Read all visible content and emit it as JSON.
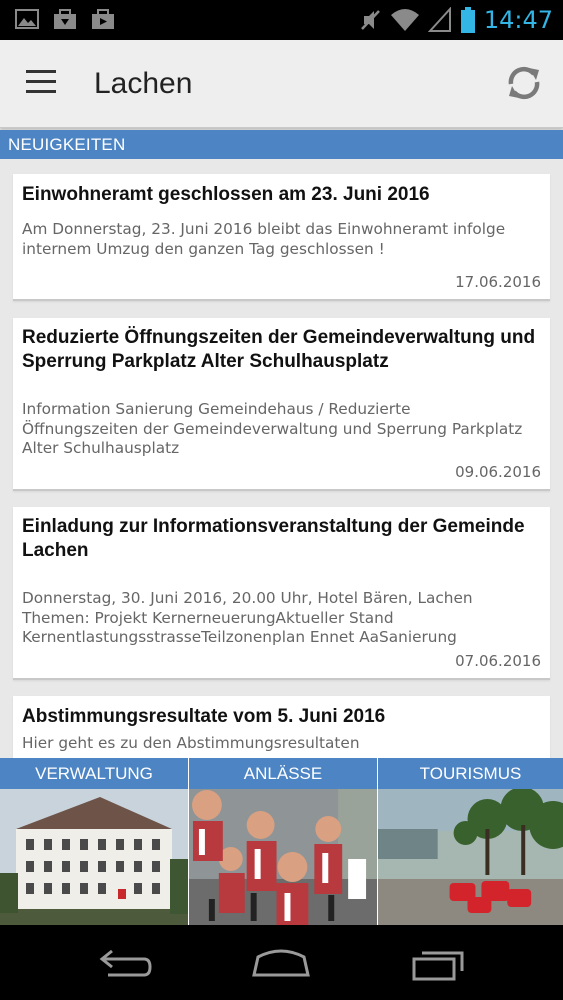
{
  "status_bar": {
    "time": "14:47",
    "icons": [
      "image-icon",
      "download-icon",
      "briefcase-icon",
      "mute-icon",
      "wifi-icon",
      "signal-icon",
      "battery-icon"
    ]
  },
  "app_bar": {
    "title": "Lachen",
    "icons": [
      "menu-icon",
      "refresh-icon"
    ]
  },
  "section": {
    "title": "NEUIGKEITEN"
  },
  "news": [
    {
      "title": "Einwohneramt geschlossen am 23. Juni 2016",
      "text": "Am Donnerstag, 23. Juni 2016 bleibt das Einwohneramt infolge\ninternem Umzug den ganzen Tag geschlossen !",
      "date": "17.06.2016"
    },
    {
      "title": "Reduzierte Öffnungszeiten der Gemeindeverwaltung und Sperrung Parkplatz Alter Schulhausplatz",
      "text": "Information Sanierung Gemeindehaus / Reduzierte\nÖffnungszeiten der Gemeindeverwaltung und Sperrung Parkplatz\nAlter Schulhausplatz",
      "date": "09.06.2016"
    },
    {
      "title": "Einladung zur Informationsveranstaltung der Gemeinde Lachen",
      "text": "Donnerstag, 30. Juni 2016, 20.00 Uhr, Hotel Bären, Lachen\nThemen:  Projekt KernerneuerungAktueller Stand\nKernentlastungsstrasseTeilzonenplan Ennet AaSanierung",
      "date": "07.06.2016"
    },
    {
      "title": "Abstimmungsresultate vom 5. Juni 2016",
      "text": "Hier geht es zu den Abstimmungsresultaten",
      "date": ""
    }
  ],
  "categories": [
    {
      "label": "VERWALTUNG"
    },
    {
      "label": "ANLÄSSE"
    },
    {
      "label": "TOURISMUS"
    }
  ],
  "nav_bar": {
    "icons": [
      "back-icon",
      "home-icon",
      "recents-icon"
    ]
  },
  "colors": {
    "accent": "#4c84c4",
    "clock": "#33b5e5",
    "app_bar_bg": "#eeeeee",
    "page_bg": "#e8e8e8"
  }
}
